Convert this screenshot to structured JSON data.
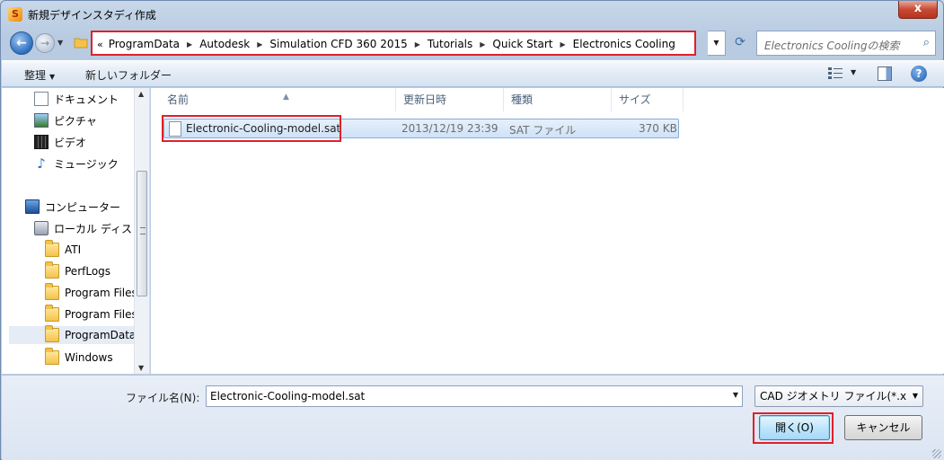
{
  "window": {
    "title": "新規デザインスタディ作成",
    "close_glyph": "x"
  },
  "address": {
    "lead": "«",
    "crumbs": [
      "ProgramData",
      "Autodesk",
      "Simulation CFD 360 2015",
      "Tutorials",
      "Quick Start",
      "Electronics Cooling"
    ],
    "search_placeholder": "Electronics Coolingの検索"
  },
  "toolbar": {
    "organize_label": "整理",
    "new_folder_label": "新しいフォルダー"
  },
  "nav": {
    "items": [
      {
        "label": "ドキュメント",
        "icon": "document-icon"
      },
      {
        "label": "ピクチャ",
        "icon": "picture-icon"
      },
      {
        "label": "ビデオ",
        "icon": "video-icon"
      },
      {
        "label": "ミュージック",
        "icon": "music-icon"
      },
      {
        "label": "コンピューター",
        "icon": "computer-icon"
      },
      {
        "label": "ローカル ディス",
        "icon": "disk-icon"
      },
      {
        "label": "ATI",
        "icon": "folder-icon"
      },
      {
        "label": "PerfLogs",
        "icon": "folder-icon"
      },
      {
        "label": "Program Files",
        "icon": "folder-icon"
      },
      {
        "label": "Program Files",
        "icon": "folder-icon"
      },
      {
        "label": "ProgramData",
        "icon": "folder-icon"
      },
      {
        "label": "Windows",
        "icon": "folder-icon"
      }
    ],
    "selected": "ProgramData"
  },
  "file_list": {
    "columns": [
      "名前",
      "更新日時",
      "種類",
      "サイズ"
    ],
    "rows": [
      {
        "name": "Electronic-Cooling-model.sat",
        "modified": "2013/12/19 23:39",
        "type": "SAT ファイル",
        "size": "370 KB"
      }
    ]
  },
  "footer": {
    "file_name_label": "ファイル名(N):",
    "file_name_value": "Electronic-Cooling-model.sat",
    "file_type": "CAD ジオメトリ ファイル(*.x",
    "open_label": "開く(O)",
    "cancel_label": "キャンセル"
  },
  "colors": {
    "highlight": "#e0202a",
    "selection": "#cfe2f7"
  }
}
